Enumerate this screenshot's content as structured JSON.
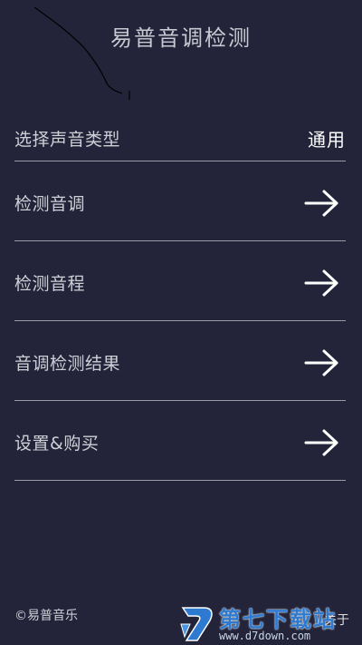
{
  "header": {
    "title": "易普音调检测"
  },
  "menu": {
    "items": [
      {
        "label": "选择声音类型",
        "value": "通用"
      },
      {
        "label": "检测音调"
      },
      {
        "label": "检测音程"
      },
      {
        "label": "音调检测结果"
      },
      {
        "label": "设置&购买"
      }
    ]
  },
  "footer": {
    "copyright": "©易普音乐",
    "partial_right": "关于"
  },
  "watermark": {
    "brand": "第七下载站",
    "url": "www.d7down.com",
    "icon": "d7-logo-icon"
  },
  "colors": {
    "background": "#23243a",
    "divider": "#9a9aa6",
    "watermark_blue": "#2e7ad0"
  }
}
